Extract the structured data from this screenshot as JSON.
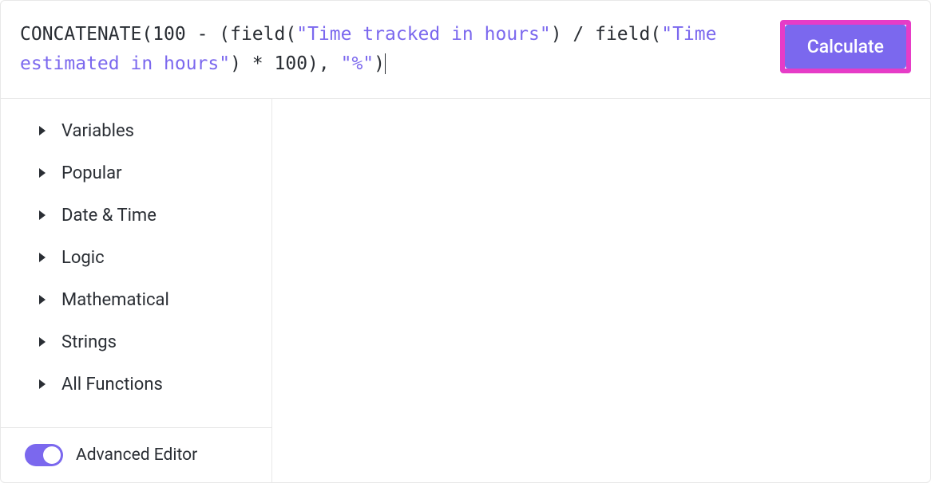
{
  "formula": {
    "tokens": [
      {
        "type": "func",
        "text": "CONCATENATE"
      },
      {
        "type": "plain",
        "text": "(100 - ("
      },
      {
        "type": "func",
        "text": "field"
      },
      {
        "type": "plain",
        "text": "("
      },
      {
        "type": "str",
        "text": "\"Time tracked in hours\""
      },
      {
        "type": "plain",
        "text": ") / "
      },
      {
        "type": "func",
        "text": "field"
      },
      {
        "type": "plain",
        "text": "("
      },
      {
        "type": "str",
        "text": "\"Time estimated in hours\""
      },
      {
        "type": "plain",
        "text": ") * 100), "
      },
      {
        "type": "str",
        "text": "\"%\""
      },
      {
        "type": "plain",
        "text": ")"
      }
    ]
  },
  "calculate_label": "Calculate",
  "categories": [
    {
      "label": "Variables"
    },
    {
      "label": "Popular"
    },
    {
      "label": "Date & Time"
    },
    {
      "label": "Logic"
    },
    {
      "label": "Mathematical"
    },
    {
      "label": "Strings"
    },
    {
      "label": "All Functions"
    }
  ],
  "advanced_editor": {
    "label": "Advanced Editor",
    "enabled": true
  }
}
